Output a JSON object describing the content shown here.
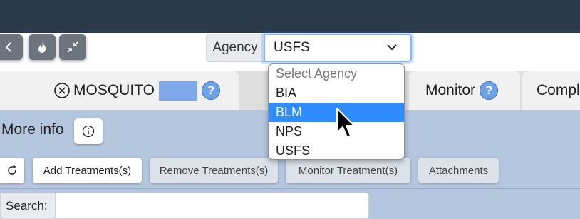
{
  "toolbar": {
    "back_icon": "chevron-left-icon",
    "fire_icon": "fire-icon",
    "collapse_icon": "collapse-arrows-icon",
    "agency": {
      "label": "Agency",
      "value": "USFS",
      "options": [
        {
          "label": "Select Agency",
          "placeholder": true
        },
        {
          "label": "BIA"
        },
        {
          "label": "BLM",
          "highlighted": true
        },
        {
          "label": "NPS"
        },
        {
          "label": "USFS"
        }
      ]
    }
  },
  "tabs": {
    "mosquito": {
      "label": "MOSQUITO",
      "help": "?"
    },
    "monitor": {
      "label": "Monitor",
      "help": "?"
    },
    "compl": {
      "label": "Compl"
    }
  },
  "panel": {
    "more_info": "More info",
    "buttons": {
      "add": "Add Treatments(s)",
      "remove": "Remove Treatments(s)",
      "monitor": "Monitor Treatment(s)",
      "attachments": "Attachments"
    },
    "search_label": "Search:"
  },
  "colors": {
    "topbar": "#2b3a4a",
    "panel": "#b5c7df",
    "highlight": "#2f8cff",
    "help_badge": "#6fa2e3"
  }
}
